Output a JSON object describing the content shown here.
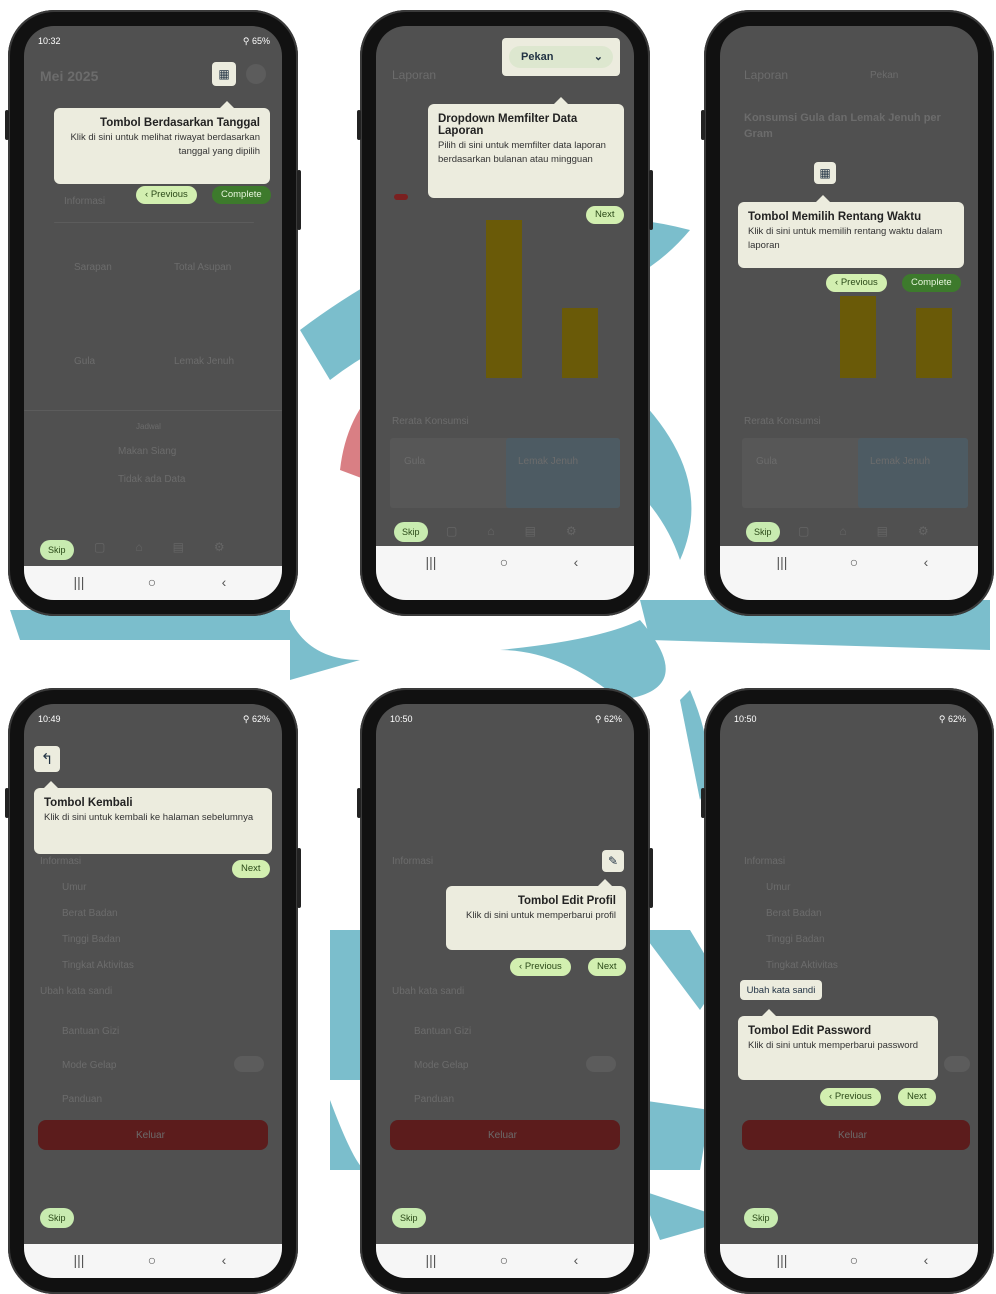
{
  "colors": {
    "accent_green": "#d2efb0",
    "dark_green": "#3d7a2c",
    "tooltip_bg": "#ececde",
    "overlay": "#505050",
    "logo_teal": "#7bbecc"
  },
  "phones": [
    {
      "status": {
        "time": "10:32",
        "icons": "⚲ 65%"
      },
      "ghost_title": "Mei 2025",
      "tip": {
        "title": "Tombol Berdasarkan Tanggal",
        "desc": "Klik di sini untuk melihat riwayat berdasarkan tanggal yang dipilih"
      },
      "prev_label": "Previous",
      "complete_label": "Complete",
      "skip_label": "Skip",
      "ghost_items": [
        "Informasi",
        "Sarapan",
        "Total Asupan",
        "Gula",
        "Lemak Jenuh",
        "Jadwal",
        "Makan Siang",
        "Tidak ada Data"
      ],
      "nav_icon_names": [
        "recent-apps-icon",
        "home-icon",
        "back-icon"
      ]
    },
    {
      "status": {
        "time": "",
        "icons": ""
      },
      "dropdown_value": "Pekan",
      "ghost_title": "Laporan",
      "tip": {
        "title": "Dropdown Memfilter Data Laporan",
        "desc": "Pilih di sini untuk memfilter data laporan berdasarkan bulanan atau mingguan"
      },
      "next_label": "Next",
      "skip_label": "Skip",
      "ghost_items": [
        "Rerata Konsumsi",
        "Gula",
        "Lemak Jenuh"
      ]
    },
    {
      "status": {
        "time": "",
        "icons": ""
      },
      "ghost_title": "Laporan",
      "ghost_dropdown": "Pekan",
      "ghost_heading": "Konsumsi Gula dan Lemak Jenuh per Gram",
      "tip": {
        "title": "Tombol Memilih Rentang Waktu",
        "desc": "Klik di sini untuk memilih rentang waktu dalam laporan"
      },
      "prev_label": "Previous",
      "complete_label": "Complete",
      "skip_label": "Skip",
      "ghost_items": [
        "Rerata Konsumsi",
        "Gula",
        "Lemak Jenuh"
      ]
    },
    {
      "status": {
        "time": "10:49",
        "icons": "⚲ 62%"
      },
      "tip": {
        "title": "Tombol Kembali",
        "desc": "Klik di sini untuk kembali ke halaman sebelumnya"
      },
      "next_label": "Next",
      "skip_label": "Skip",
      "ghost_items": [
        "Informasi",
        "Umur",
        "Berat Badan",
        "Tinggi Badan",
        "Tingkat Aktivitas",
        "Ubah kata sandi",
        "Bantuan Gizi",
        "Mode Gelap",
        "Panduan",
        "Keluar"
      ]
    },
    {
      "status": {
        "time": "10:50",
        "icons": "⚲ 62%"
      },
      "tip": {
        "title": "Tombol Edit Profil",
        "desc": "Klik di sini untuk memperbarui profil"
      },
      "prev_label": "Previous",
      "next_label": "Next",
      "skip_label": "Skip",
      "ghost_items": [
        "Informasi",
        "Umur",
        "Berat Badan",
        "Tinggi Badan",
        "Tingkat Aktivitas",
        "Ubah kata sandi",
        "Bantuan Gizi",
        "Mode Gelap",
        "Panduan",
        "Keluar"
      ]
    },
    {
      "status": {
        "time": "10:50",
        "icons": "⚲ 62%"
      },
      "highlight_label": "Ubah kata sandi",
      "tip": {
        "title": "Tombol Edit Password",
        "desc": "Klik di sini untuk memperbarui password"
      },
      "prev_label": "Previous",
      "next_label": "Next",
      "skip_label": "Skip",
      "ghost_items": [
        "Informasi",
        "Umur",
        "Berat Badan",
        "Tinggi Badan",
        "Tingkat Aktivitas",
        "Panduan",
        "Keluar"
      ]
    }
  ]
}
